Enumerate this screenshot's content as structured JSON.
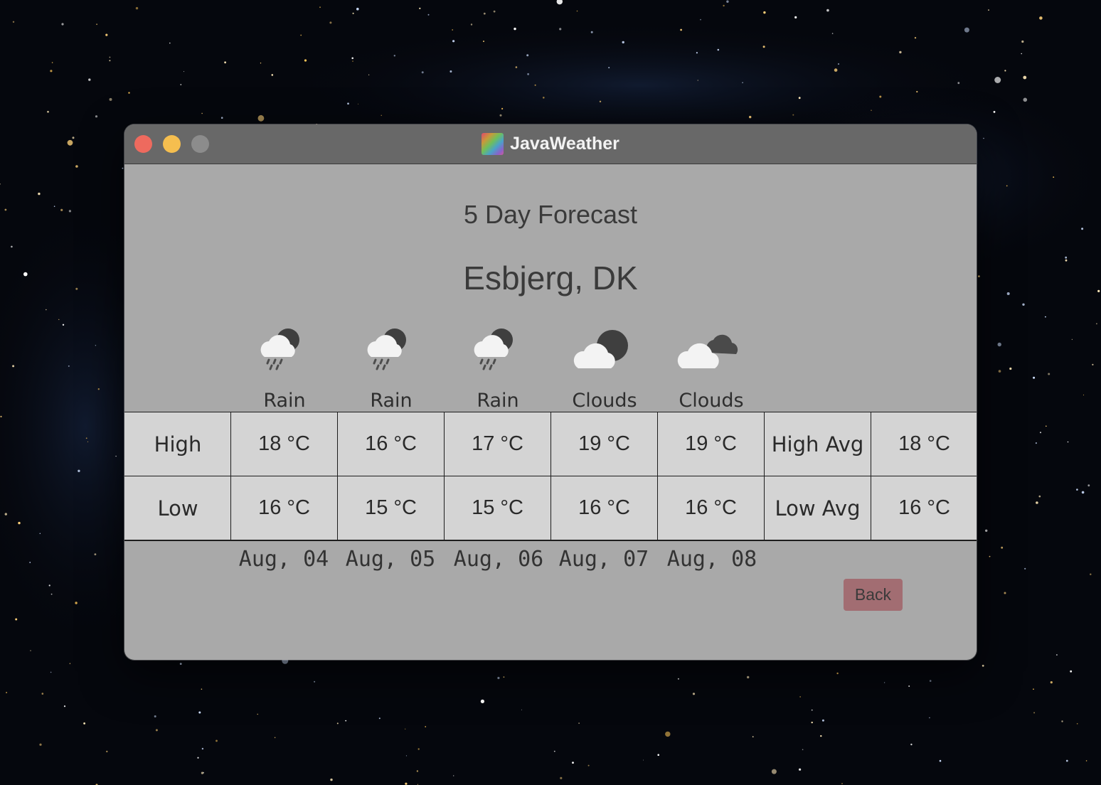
{
  "window": {
    "title": "JavaWeather"
  },
  "forecast": {
    "heading": "5 Day Forecast",
    "location": "Esbjerg, DK",
    "days": [
      {
        "condition": "Rain",
        "icon": "rain-cloud-moon-icon",
        "high": "18 °C",
        "low": "16 °C",
        "date": "Aug, 04"
      },
      {
        "condition": "Rain",
        "icon": "rain-cloud-moon-icon",
        "high": "16 °C",
        "low": "15 °C",
        "date": "Aug, 05"
      },
      {
        "condition": "Rain",
        "icon": "rain-cloud-moon-icon",
        "high": "17 °C",
        "low": "15 °C",
        "date": "Aug, 06"
      },
      {
        "condition": "Clouds",
        "icon": "cloud-moon-icon",
        "high": "19 °C",
        "low": "16 °C",
        "date": "Aug, 07"
      },
      {
        "condition": "Clouds",
        "icon": "broken-clouds-icon",
        "high": "19 °C",
        "low": "16 °C",
        "date": "Aug, 08"
      }
    ]
  },
  "table": {
    "high_label": "High",
    "low_label": "Low",
    "high_avg_label": "High Avg",
    "low_avg_label": "Low Avg",
    "high_avg": "18 °C",
    "low_avg": "16 °C"
  },
  "buttons": {
    "back": "Back"
  },
  "colors": {
    "window_bg": "#a9a9a9",
    "titlebar": "#686868",
    "table_cell": "#d4d4d4",
    "back_button": "#a26d72",
    "close": "#ee6a5e",
    "minimize": "#f5be4f",
    "maximize": "#8c8c8c"
  }
}
